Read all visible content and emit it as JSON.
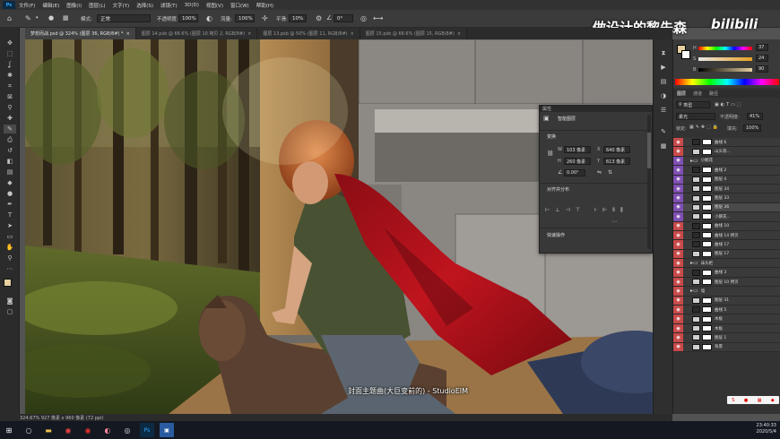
{
  "app": {
    "logo": "Ps"
  },
  "menu": [
    "文件(F)",
    "编辑(E)",
    "图像(I)",
    "图层(L)",
    "文字(Y)",
    "选择(S)",
    "滤镜(T)",
    "3D(D)",
    "视图(V)",
    "窗口(W)",
    "帮助(H)"
  ],
  "options": {
    "mode_label": "模式:",
    "mode_value": "正常",
    "opacity_label": "不透明度:",
    "opacity_value": "100%",
    "flow_label": "流量:",
    "flow_value": "100%",
    "smooth_label": "平滑:",
    "smooth_value": "10%",
    "angle_value": "0°"
  },
  "tabs": [
    {
      "label": "梦想而战.psd @ 324% (图层 36, RGB/8#) *",
      "active": true
    },
    {
      "label": "图层 14.psb @ 66.6% (图层 10 拷贝 2, RGB/8#)",
      "active": false
    },
    {
      "label": "图层 13.psb @ 50% (图层 11, RGB/8#)",
      "active": false
    },
    {
      "label": "图层 15.psb @ 66.6% (图层 15, RGB/8#)",
      "active": false
    }
  ],
  "watermark": {
    "text": "做设计的黎先森",
    "brand": "bilibili"
  },
  "subtitle": "封面主题曲(大巨变前的) - StudioEIM",
  "properties": {
    "header": "属性",
    "title": "智能图层",
    "transform_label": "变换",
    "w_label": "W",
    "w_value": "103 像素",
    "x_label": "X",
    "x_value": "640 像素",
    "h_label": "H",
    "h_value": "260 像素",
    "y_label": "Y",
    "y_value": "613 像素",
    "angle_value": "0.00°",
    "align_label": "对齐并分布",
    "quick_label": "快速操作"
  },
  "color": {
    "fg": "#e6d0a0",
    "bg": "#ffffff",
    "h_label": "H",
    "s_label": "S",
    "b_label": "B",
    "h_value": "37",
    "s_value": "24",
    "b_value": "90"
  },
  "layers_panel": {
    "tabs": [
      "图层",
      "通道",
      "路径"
    ],
    "filter_value": "类型",
    "blend_value": "柔光",
    "opacity_label": "不透明度:",
    "opacity_value": "41%",
    "lock_label": "锁定:",
    "fill_label": "填充:",
    "fill_value": "100%",
    "rows": [
      {
        "name": "曲线 6",
        "color": "#c94a4a",
        "kind": "adj"
      },
      {
        "name": "山头等...",
        "color": "#c94a4a",
        "kind": "img"
      },
      {
        "name": "小鹅花",
        "color": "#7f4fb3",
        "kind": "group"
      },
      {
        "name": "曲线 2",
        "color": "#7f4fb3",
        "kind": "adj"
      },
      {
        "name": "图层 4",
        "color": "#7f4fb3",
        "kind": "img"
      },
      {
        "name": "图层 34",
        "color": "#7f4fb3",
        "kind": "img"
      },
      {
        "name": "图层 33",
        "color": "#7f4fb3",
        "kind": "img"
      },
      {
        "name": "图层 36",
        "color": "#7f4fb3",
        "kind": "img",
        "selected": true
      },
      {
        "name": "小鹅花...",
        "color": "#7f4fb3",
        "kind": "img"
      },
      {
        "name": "曲线 10",
        "color": "#c94a4a",
        "kind": "adj"
      },
      {
        "name": "曲线 14 拷贝",
        "color": "#c94a4a",
        "kind": "adj"
      },
      {
        "name": "曲线 17",
        "color": "#c94a4a",
        "kind": "adj"
      },
      {
        "name": "图层 17",
        "color": "#c94a4a",
        "kind": "img"
      },
      {
        "name": "床头柜",
        "color": "#c94a4a",
        "kind": "group"
      },
      {
        "name": "曲线 3",
        "color": "#c94a4a",
        "kind": "adj"
      },
      {
        "name": "图层 10 拷贝",
        "color": "#c94a4a",
        "kind": "img"
      },
      {
        "name": "墙",
        "color": "#c94a4a",
        "kind": "group"
      },
      {
        "name": "图层 31",
        "color": "#c94a4a",
        "kind": "img"
      },
      {
        "name": "曲线 5",
        "color": "#c94a4a",
        "kind": "adj"
      },
      {
        "name": "木板",
        "color": "#c94a4a",
        "kind": "img"
      },
      {
        "name": "木板",
        "color": "#c94a4a",
        "kind": "img"
      },
      {
        "name": "图层 1",
        "color": "#c94a4a",
        "kind": "img"
      },
      {
        "name": "背景",
        "color": "#c94a4a",
        "kind": "img"
      }
    ]
  },
  "status": {
    "text": "324.67%   927 像素 x 960 像素 (72 ppi)"
  },
  "taskbar": {
    "time": "23:40:33",
    "date": "2020/5/4"
  },
  "icons": {
    "home": "home-icon",
    "brush": "brush-icon",
    "move": "move-tool-icon",
    "eye": "eye-icon",
    "search": "search-icon"
  }
}
